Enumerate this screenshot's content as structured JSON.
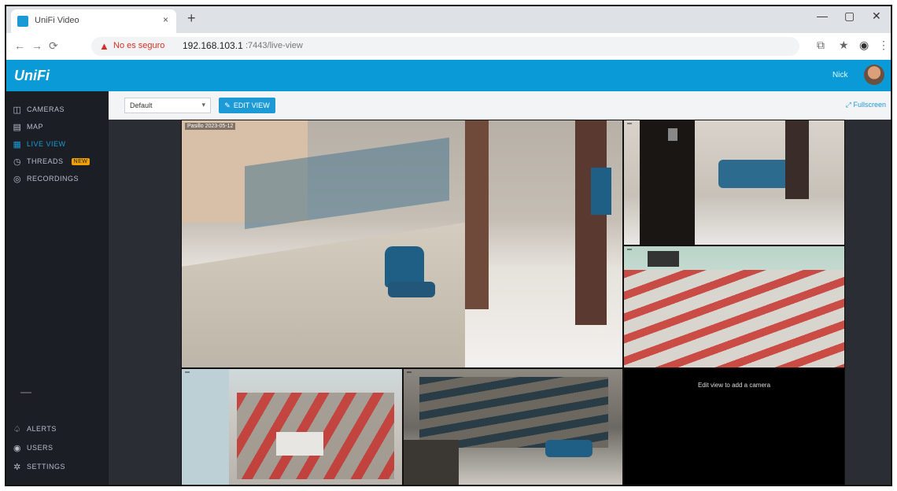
{
  "browser": {
    "tab_title": "UniFi Video",
    "tab_close": "×",
    "new_tab": "+",
    "security_label": "No es seguro",
    "url_host": "192.168.103.1",
    "url_path": ":7443/live-view",
    "window_controls": [
      "—",
      "▢",
      "✕"
    ]
  },
  "app": {
    "logo": "UniFi",
    "user_name": "Nick"
  },
  "sidebar": {
    "items": [
      {
        "label": "CAMERAS",
        "icon": "camera-icon",
        "glyph": "◫"
      },
      {
        "label": "MAP",
        "icon": "map-icon",
        "glyph": "▤"
      },
      {
        "label": "LIVE VIEW",
        "icon": "live-view-icon",
        "glyph": "▦"
      },
      {
        "label": "THREADS",
        "icon": "threads-icon",
        "glyph": "◷",
        "badge": "NEW"
      },
      {
        "label": "RECORDINGS",
        "icon": "recordings-icon",
        "glyph": "◎"
      }
    ],
    "bottom_items": [
      {
        "label": "ALERTS",
        "icon": "bell-icon",
        "glyph": "♤"
      },
      {
        "label": "USERS",
        "icon": "users-icon",
        "glyph": "◉"
      },
      {
        "label": "SETTINGS",
        "icon": "gear-icon",
        "glyph": "✲"
      }
    ]
  },
  "toolbar": {
    "view_select_value": "Default",
    "edit_label": "EDIT VIEW",
    "fullscreen_label": "Fullscreen"
  },
  "cameras": [
    {
      "label": "Pasillo 2023-05-12"
    },
    {
      "label": ""
    },
    {
      "label": ""
    },
    {
      "label": ""
    },
    {
      "label": ""
    },
    {
      "label": "",
      "empty_text": "Edit view to add a camera"
    }
  ],
  "colors": {
    "header": "#0a9ad8",
    "sidebar": "#1b1e24",
    "accent": "#1b9ad6",
    "badge": "#f0a000"
  }
}
